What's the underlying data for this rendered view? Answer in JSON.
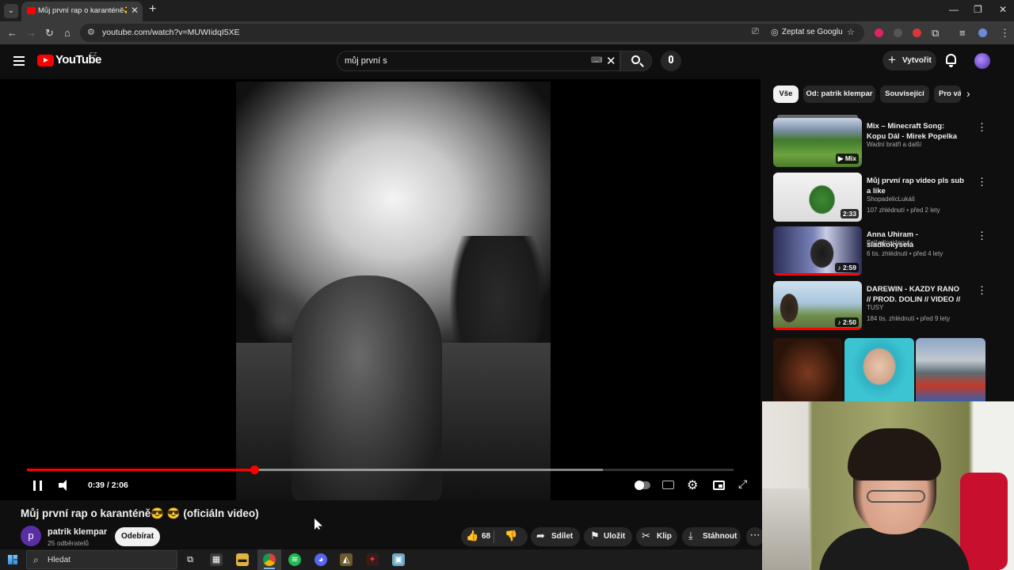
{
  "browser": {
    "tab_title": "Můj první rap o karanténě😎 🔊",
    "url": "youtube.com/watch?v=MUWIidqI5XE",
    "ask_google": "Zeptat se Googlu",
    "colors": {
      "tab_bg": "#3a3a3a",
      "chrome_bg": "#1f1f1f"
    }
  },
  "header": {
    "logo_text": "YouTube",
    "logo_region": "CZ",
    "search_value": "můj první s",
    "create_label": "Vytvořit"
  },
  "player": {
    "time": "0:39 / 2:06",
    "played_fraction": 0.3217,
    "buffered_fraction": 0.8147,
    "state": "playing"
  },
  "video": {
    "title": "Můj první rap o karanténě😎 😎  (oficiáln video)",
    "channel_initial": "p",
    "channel_name": "patrik klempar",
    "subscribers": "25 odběratelů",
    "subscribe_label": "Odebírat",
    "likes": "68",
    "share_label": "Sdílet",
    "save_label": "Uložit",
    "clip_label": "Klip",
    "download_label": "Stáhnout"
  },
  "sidebar": {
    "chips": [
      "Vše",
      "Od: patrik klempar",
      "Související",
      "Pro vás"
    ],
    "recommendations": [
      {
        "title": "Mix – Minecraft Song: Kopu Dál - Mirek Popelka  [+KLIP]",
        "channel": "Wadní bratři a další",
        "meta": "",
        "badge": "Mix",
        "progress": 0
      },
      {
        "title": "Můj první rap video pls sub a like",
        "channel": "ShopadelicLukáš",
        "meta": "107 zhlédnutí • před 2 lety",
        "badge": "2:33",
        "progress": 0
      },
      {
        "title": "Anna Uhiram - sladkokyselá",
        "channel": "Balladinsideout",
        "meta": "6 tis. zhlédnutí • před 4 lety",
        "badge": "2:59",
        "progress": 1
      },
      {
        "title": "DAREWIN - KAZDY RANO // PROD. DOLIN // VIDEO // ...",
        "channel": "TUSY",
        "meta": "184 tis. zhlédnutí • před 9 lety",
        "badge": "2:50",
        "progress": 1
      }
    ]
  },
  "taskbar": {
    "search_placeholder": "Hledat"
  }
}
